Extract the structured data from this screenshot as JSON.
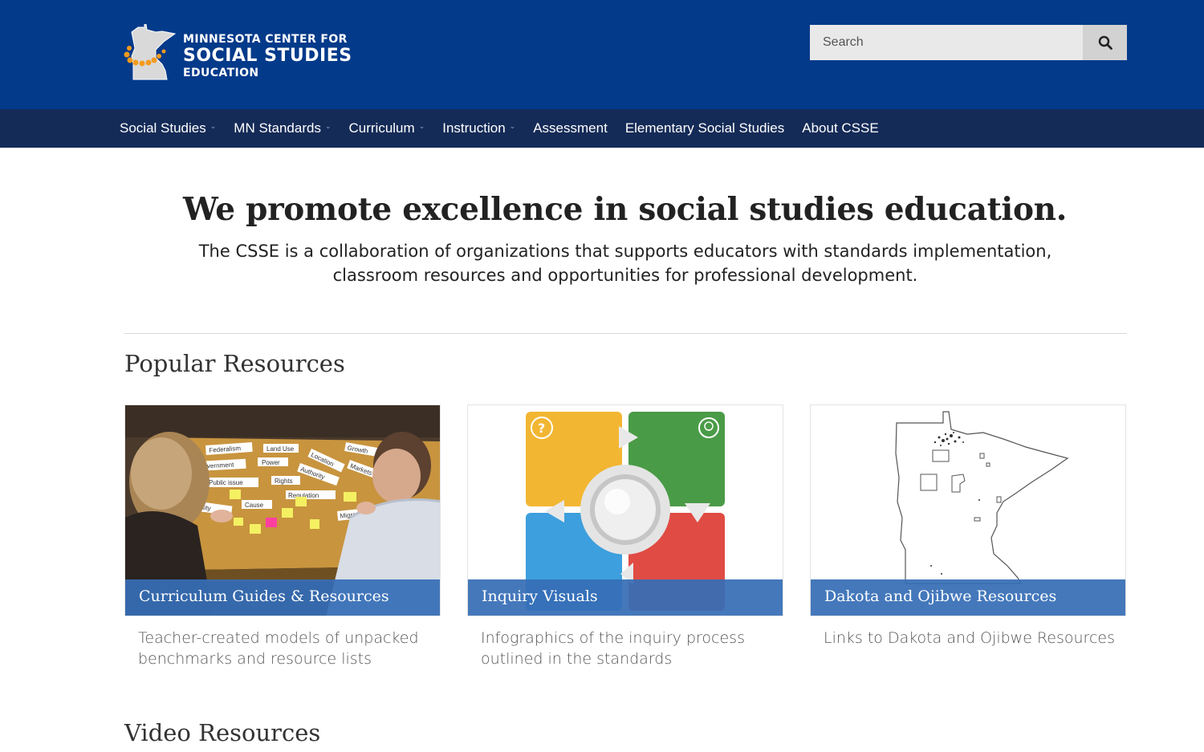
{
  "header": {
    "logo": {
      "line1": "MINNESOTA CENTER FOR",
      "line2": "SOCIAL STUDIES",
      "line3": "EDUCATION"
    },
    "search": {
      "placeholder": "Search"
    }
  },
  "nav": {
    "items": [
      {
        "label": "Social Studies",
        "has_dropdown": true
      },
      {
        "label": "MN Standards",
        "has_dropdown": true
      },
      {
        "label": "Curriculum",
        "has_dropdown": true
      },
      {
        "label": "Instruction",
        "has_dropdown": true
      },
      {
        "label": "Assessment",
        "has_dropdown": false
      },
      {
        "label": "Elementary Social Studies",
        "has_dropdown": false
      },
      {
        "label": "About CSSE",
        "has_dropdown": false
      }
    ]
  },
  "hero": {
    "title": "We promote excellence in social studies education.",
    "subtitle": "The CSSE is a collaboration of organizations that supports educators with standards implementation, classroom resources and opportunities for professional development."
  },
  "popular": {
    "heading": "Popular Resources",
    "cards": [
      {
        "label": "Curriculum Guides & Resources",
        "description": "Teacher-created models of unpacked benchmarks and resource lists"
      },
      {
        "label": "Inquiry Visuals",
        "description": "Infographics of the inquiry process outlined in the standards"
      },
      {
        "label": "Dakota and Ojibwe Resources",
        "description": "Links to Dakota and Ojibwe Resources"
      }
    ]
  },
  "photo_words": [
    "Federalism",
    "Land Use",
    "Growth",
    "Government",
    "Power",
    "Location",
    "Authority",
    "Markets",
    "Public issue",
    "Rights",
    "Regulation",
    "Identity",
    "Cause",
    "Migration"
  ],
  "video": {
    "heading": "Video Resources"
  },
  "colors": {
    "header_bg": "#033a8a",
    "nav_bg": "#152b57",
    "card_label_bg": "#366eb6"
  }
}
